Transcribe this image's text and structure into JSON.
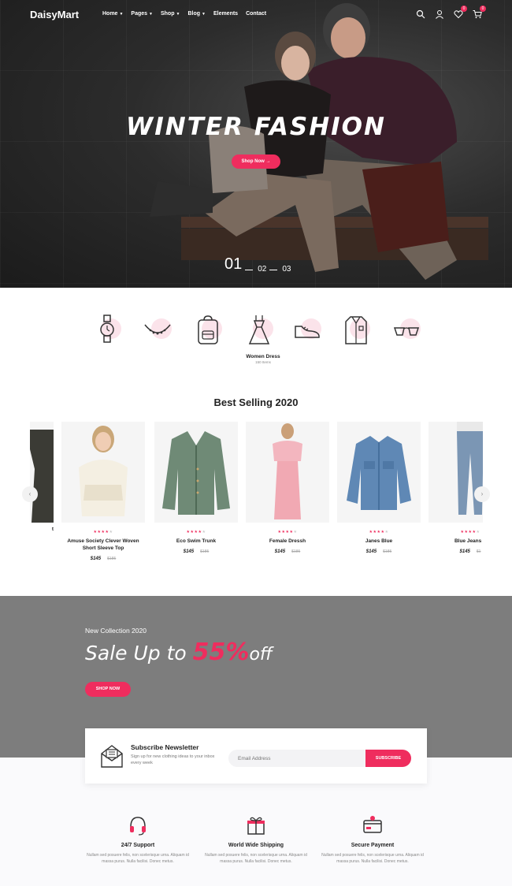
{
  "brand": "DaisyMart",
  "nav": {
    "items": [
      {
        "label": "Home",
        "has_dropdown": true
      },
      {
        "label": "Pages",
        "has_dropdown": true
      },
      {
        "label": "Shop",
        "has_dropdown": true
      },
      {
        "label": "Blog",
        "has_dropdown": true
      },
      {
        "label": "Elements",
        "has_dropdown": false
      },
      {
        "label": "Contact",
        "has_dropdown": false
      }
    ],
    "icons": [
      "search-icon",
      "user-icon",
      "heart-icon",
      "cart-icon"
    ],
    "wishlist_count": "0",
    "cart_count": "0"
  },
  "hero": {
    "title": "WINTER FASHION",
    "button": "Shop Now",
    "slides": [
      "01",
      "02",
      "03"
    ],
    "active_slide": "01"
  },
  "categories": {
    "items": [
      {
        "icon": "watch-icon"
      },
      {
        "icon": "necklace-icon"
      },
      {
        "icon": "backpack-icon"
      },
      {
        "icon": "dress-icon",
        "label": "Women Dress",
        "sub": "150 Items"
      },
      {
        "icon": "shoe-icon"
      },
      {
        "icon": "shirt-icon"
      },
      {
        "icon": "sunglasses-icon"
      }
    ]
  },
  "best_selling": {
    "title": "Best Selling 2020",
    "products": [
      {
        "name": "t",
        "rating": 0,
        "price": "",
        "old_price": ""
      },
      {
        "name": "Amuse Society Clever Woven Short Sleeve Top",
        "rating": 4,
        "price": "$145",
        "old_price": "$185"
      },
      {
        "name": "Eco Swim Trunk",
        "rating": 4,
        "price": "$145",
        "old_price": "$185"
      },
      {
        "name": "Female Dressh",
        "rating": 4,
        "price": "$145",
        "old_price": "$185"
      },
      {
        "name": "Janes Blue",
        "rating": 4,
        "price": "$145",
        "old_price": "$185"
      },
      {
        "name": "Blue Jeans F",
        "rating": 4,
        "price": "$145",
        "old_price": "$1"
      }
    ]
  },
  "sale": {
    "kicker": "New Collection 2020",
    "title_prefix": "Sale Up to",
    "percent": "55%",
    "suffix": "off",
    "button": "SHOP NOW"
  },
  "newsletter": {
    "title": "Subscribe Newsletter",
    "text": "Sign up for new clothing ideas to your inbox every week",
    "placeholder": "Email Address",
    "button": "SUBSCRIBE"
  },
  "features": [
    {
      "icon": "headset-icon",
      "title": "24/7 Support",
      "text": "Nullam sed posuere felis, non scelerisque urna. Aliquam id massa purus. Nulla facilisi. Donec metus."
    },
    {
      "icon": "gift-icon",
      "title": "World Wide Shipping",
      "text": "Nullam sed posuere felis, non scelerisque urna. Aliquam id massa purus. Nulla facilisi. Donec metus."
    },
    {
      "icon": "card-icon",
      "title": "Secure Payment",
      "text": "Nullam sed posuere felis, non scelerisque urna. Aliquam id massa purus. Nulla facilisi. Donec metus."
    }
  ],
  "colors": {
    "accent": "#ef2d5e",
    "hero_bg": "#2c2c2c",
    "sale_bg": "#7d7d7d"
  }
}
